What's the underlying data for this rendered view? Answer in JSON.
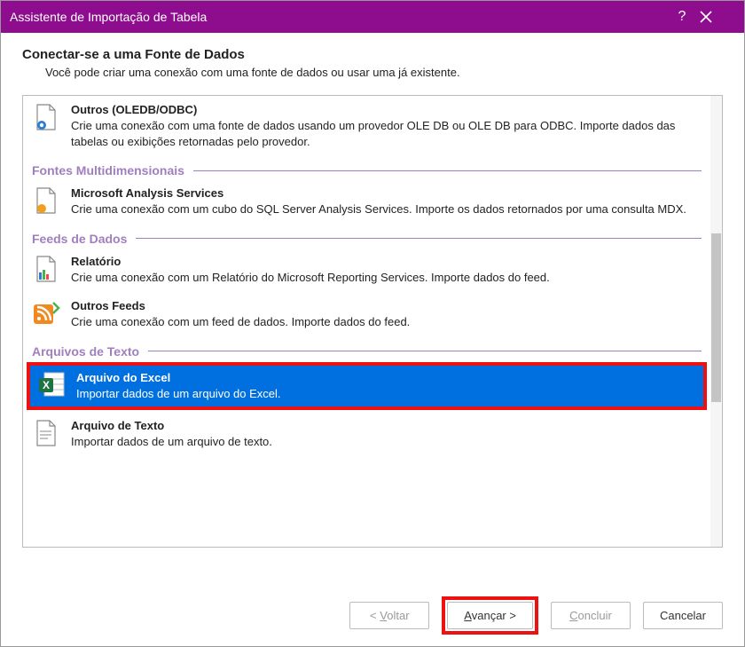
{
  "window": {
    "title": "Assistente de Importação de Tabela"
  },
  "header": {
    "title": "Conectar-se a uma Fonte de Dados",
    "subtitle": "Você pode criar uma conexão com uma fonte de dados ou usar uma já existente."
  },
  "sections": {
    "otros_title": "Outros (OLEDB/ODBC)",
    "otros_desc": "Crie uma conexão com uma fonte de dados usando um provedor OLE DB ou OLE DB para ODBC. Importe dados das tabelas ou exibições retornadas pelo provedor.",
    "multi_label": "Fontes Multidimensionais",
    "msas_title": "Microsoft Analysis Services",
    "msas_desc": "Crie uma conexão com um cubo do SQL Server Analysis Services. Importe os dados retornados por uma consulta MDX.",
    "feeds_label": "Feeds de Dados",
    "report_title": "Relatório",
    "report_desc": "Crie uma conexão com um Relatório do Microsoft Reporting Services. Importe dados do feed.",
    "other_feeds_title": "Outros Feeds",
    "other_feeds_desc": "Crie uma conexão com um feed de dados. Importe dados do feed.",
    "text_label": "Arquivos de Texto",
    "excel_title": "Arquivo do Excel",
    "excel_desc": "Importar dados de um arquivo do Excel.",
    "txt_title": "Arquivo de Texto",
    "txt_desc": "Importar dados de um arquivo de texto."
  },
  "footer": {
    "back": "< Voltar",
    "next": "Avançar >",
    "finish": "Concluir",
    "cancel": "Cancelar"
  }
}
